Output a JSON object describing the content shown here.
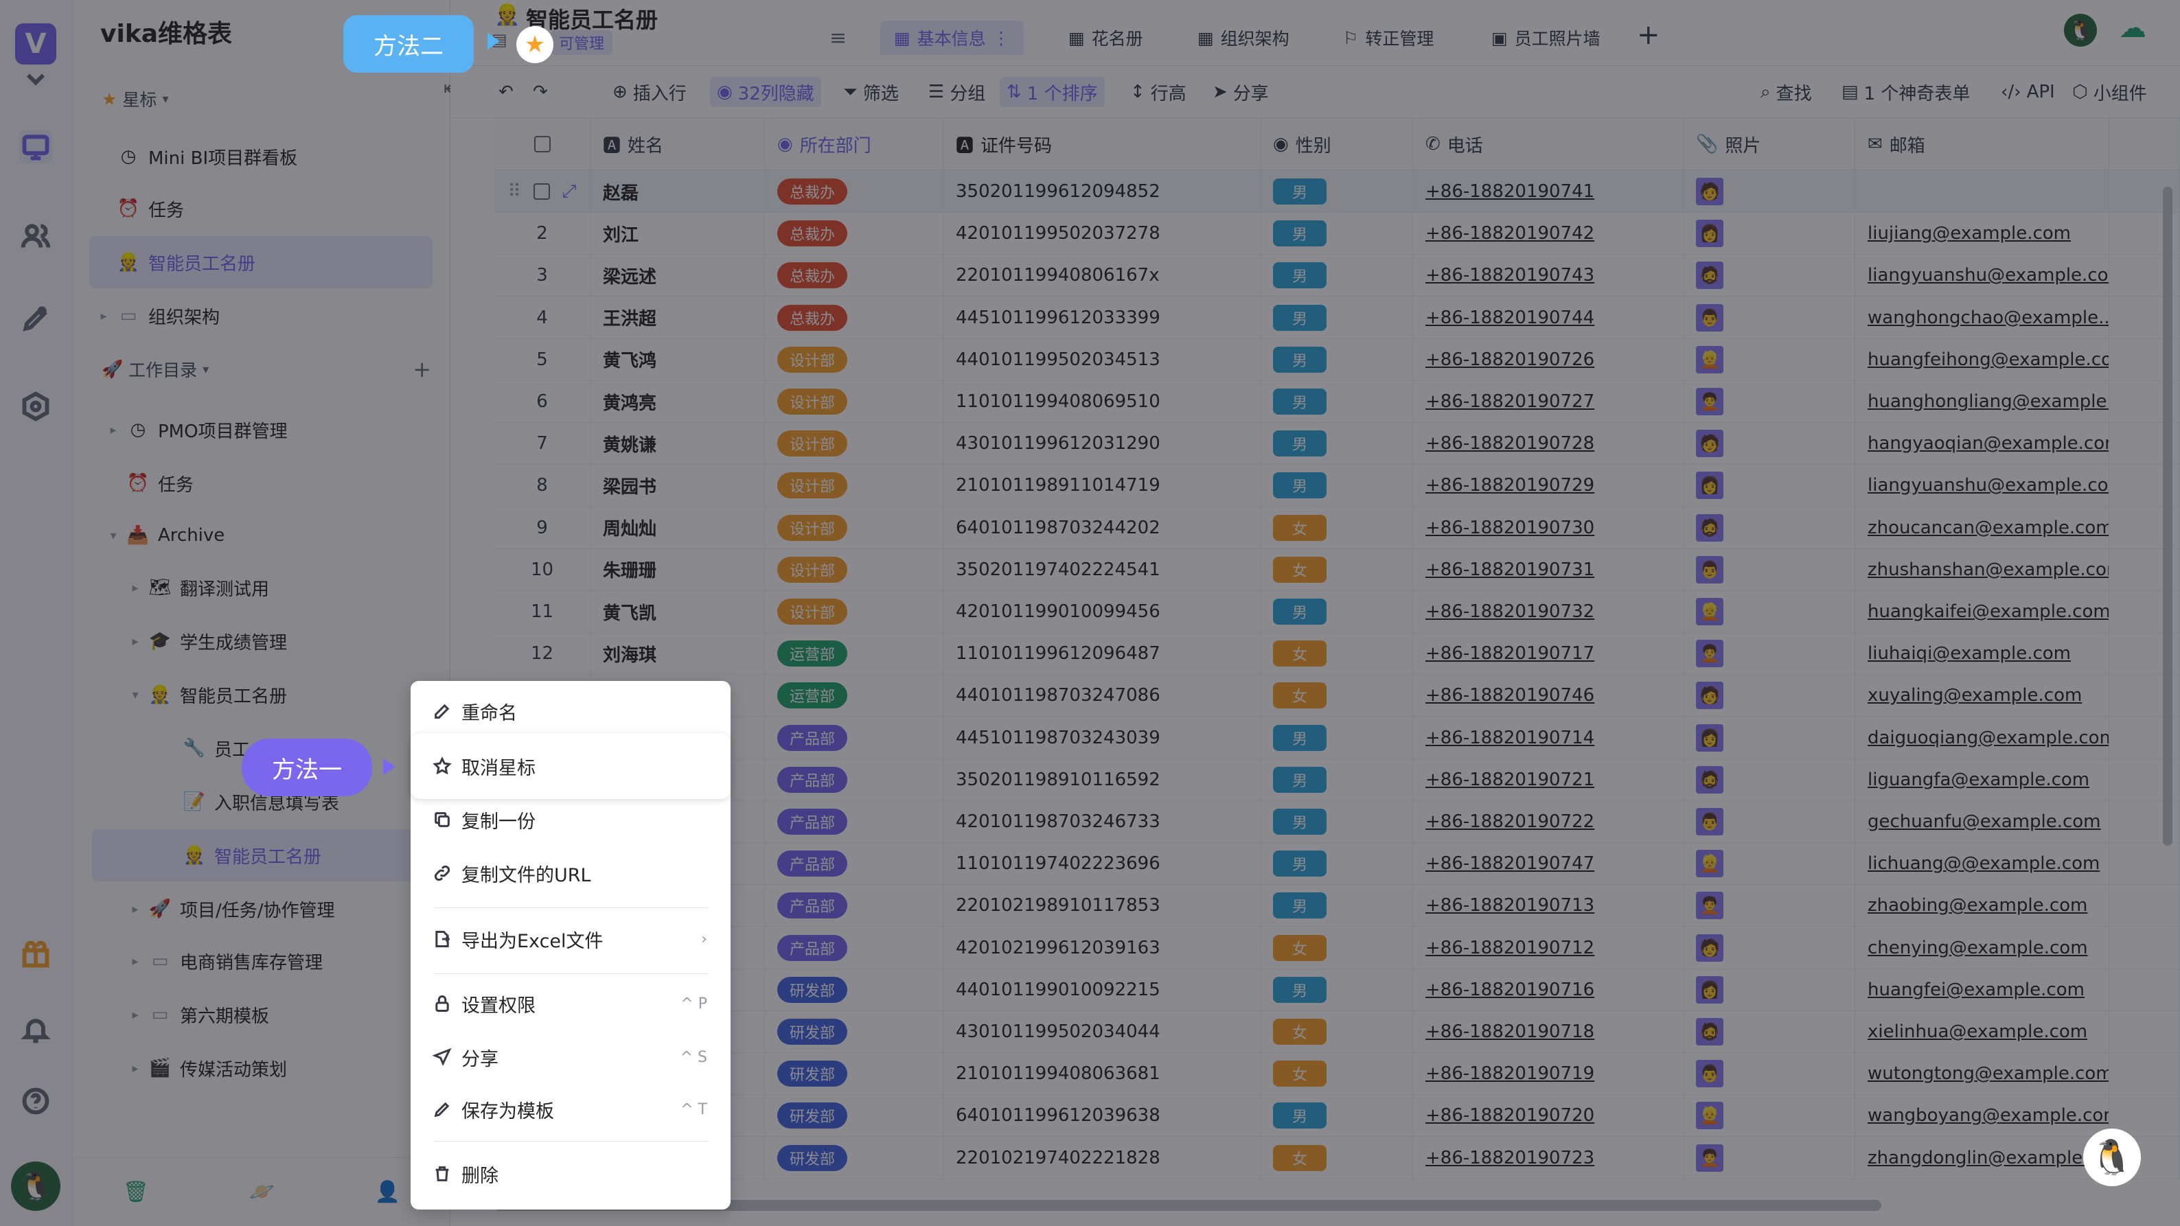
{
  "app": {
    "name": "vika维格表"
  },
  "sidebar": {
    "starred_label": "星标",
    "starred": [
      {
        "label": "Mini BI项目群看板",
        "icon": "clock-icon"
      },
      {
        "label": "任务",
        "icon": "alarm-icon"
      },
      {
        "label": "智能员工名册",
        "icon": "worker-icon"
      },
      {
        "label": "组织架构",
        "icon": "folder-icon"
      }
    ],
    "workspace_label": "工作目录",
    "tree": [
      {
        "label": "PMO项目群管理",
        "icon": "clock-icon"
      },
      {
        "label": "任务",
        "icon": "alarm-icon"
      },
      {
        "label": "Archive",
        "icon": "archive-icon"
      },
      {
        "label": "翻译测试用",
        "icon": "folder-icon"
      },
      {
        "label": "学生成绩管理",
        "icon": "folder-icon"
      },
      {
        "label": "智能员工名册",
        "icon": "worker-icon"
      },
      {
        "label": "员工",
        "icon": "wrench-icon"
      },
      {
        "label": "入职信息填写表",
        "icon": "form-icon"
      },
      {
        "label": "智能员工名册",
        "icon": "worker-icon"
      },
      {
        "label": "项目/任务/协作管理",
        "icon": "rocket-icon"
      },
      {
        "label": "电商销售库存管理",
        "icon": "folder-icon"
      },
      {
        "label": "第六期模板",
        "icon": "folder-icon"
      },
      {
        "label": "传媒活动策划",
        "icon": "folder-icon"
      }
    ]
  },
  "header": {
    "title": "智能员工名册",
    "permission": "可管理",
    "tabs": [
      "基本信息",
      "花名册",
      "组织架构",
      "转正管理",
      "员工照片墙"
    ]
  },
  "toolbar": {
    "insert_row": "插入行",
    "hidden": "32列隐藏",
    "filter": "筛选",
    "group": "分组",
    "sort": "1 个排序",
    "row_height": "行高",
    "share": "分享",
    "search": "查找",
    "form": "1 个神奇表单",
    "api": "API",
    "widget": "小组件"
  },
  "table": {
    "columns": [
      "姓名",
      "所在部门",
      "证件号码",
      "性别",
      "电话",
      "照片",
      "邮箱"
    ],
    "rows": [
      {
        "n": "",
        "name": "赵磊",
        "dept": "总裁办",
        "id": "350201199612094852",
        "sex": "男",
        "tel": "+86-18820190741",
        "mail": ""
      },
      {
        "n": "2",
        "name": "刘江",
        "dept": "总裁办",
        "id": "420101199502037278",
        "sex": "男",
        "tel": "+86-18820190742",
        "mail": "liujiang@example.com"
      },
      {
        "n": "3",
        "name": "梁远述",
        "dept": "总裁办",
        "id": "22010119940806167x",
        "sex": "男",
        "tel": "+86-18820190743",
        "mail": "liangyuanshu@example.com"
      },
      {
        "n": "4",
        "name": "王洪超",
        "dept": "总裁办",
        "id": "445101199612033399",
        "sex": "男",
        "tel": "+86-18820190744",
        "mail": "wanghongchao@example...."
      },
      {
        "n": "5",
        "name": "黄飞鸿",
        "dept": "设计部",
        "id": "440101199502034513",
        "sex": "男",
        "tel": "+86-18820190726",
        "mail": "huangfeihong@example.com"
      },
      {
        "n": "6",
        "name": "黄鸿亮",
        "dept": "设计部",
        "id": "110101199408069510",
        "sex": "男",
        "tel": "+86-18820190727",
        "mail": "huanghongliang@example...."
      },
      {
        "n": "7",
        "name": "黄姚谦",
        "dept": "设计部",
        "id": "430101199612031290",
        "sex": "男",
        "tel": "+86-18820190728",
        "mail": "hangyaoqian@example.com"
      },
      {
        "n": "8",
        "name": "梁园书",
        "dept": "设计部",
        "id": "210101198911014719",
        "sex": "男",
        "tel": "+86-18820190729",
        "mail": "liangyuanshu@example.com"
      },
      {
        "n": "9",
        "name": "周灿灿",
        "dept": "设计部",
        "id": "640101198703244202",
        "sex": "女",
        "tel": "+86-18820190730",
        "mail": "zhoucancan@example.com"
      },
      {
        "n": "10",
        "name": "朱珊珊",
        "dept": "设计部",
        "id": "350201197402224541",
        "sex": "女",
        "tel": "+86-18820190731",
        "mail": "zhushanshan@example.com"
      },
      {
        "n": "11",
        "name": "黄飞凯",
        "dept": "设计部",
        "id": "420101199010099456",
        "sex": "男",
        "tel": "+86-18820190732",
        "mail": "huangkaifei@example.com"
      },
      {
        "n": "12",
        "name": "刘海琪",
        "dept": "运营部",
        "id": "110101199612096487",
        "sex": "女",
        "tel": "+86-18820190717",
        "mail": "liuhaiqi@example.com"
      },
      {
        "n": "",
        "name": "",
        "dept": "运营部",
        "id": "440101198703247086",
        "sex": "女",
        "tel": "+86-18820190746",
        "mail": "xuyaling@example.com"
      },
      {
        "n": "",
        "name": "",
        "dept": "产品部",
        "id": "445101198703243039",
        "sex": "男",
        "tel": "+86-18820190714",
        "mail": "daiguoqiang@example.com"
      },
      {
        "n": "",
        "name": "",
        "dept": "产品部",
        "id": "350201198910116592",
        "sex": "男",
        "tel": "+86-18820190721",
        "mail": "liguangfa@example.com"
      },
      {
        "n": "",
        "name": "",
        "dept": "产品部",
        "id": "420101198703246733",
        "sex": "男",
        "tel": "+86-18820190722",
        "mail": "gechuanfu@example.com"
      },
      {
        "n": "",
        "name": "",
        "dept": "产品部",
        "id": "110101197402223696",
        "sex": "男",
        "tel": "+86-18820190747",
        "mail": "lichuang@@example.com"
      },
      {
        "n": "",
        "name": "",
        "dept": "产品部",
        "id": "220102198910117853",
        "sex": "男",
        "tel": "+86-18820190713",
        "mail": "zhaobing@example.com"
      },
      {
        "n": "",
        "name": "",
        "dept": "产品部",
        "id": "420102199612039163",
        "sex": "女",
        "tel": "+86-18820190712",
        "mail": "chenying@example.com"
      },
      {
        "n": "",
        "name": "",
        "dept": "研发部",
        "id": "440101199010092215",
        "sex": "男",
        "tel": "+86-18820190716",
        "mail": "huangfei@example.com"
      },
      {
        "n": "",
        "name": "",
        "dept": "研发部",
        "id": "430101199502034044",
        "sex": "女",
        "tel": "+86-18820190718",
        "mail": "xielinhua@example.com"
      },
      {
        "n": "",
        "name": "",
        "dept": "研发部",
        "id": "210101199408063681",
        "sex": "女",
        "tel": "+86-18820190719",
        "mail": "wutongtong@example.com"
      },
      {
        "n": "",
        "name": "",
        "dept": "研发部",
        "id": "640101199612039638",
        "sex": "男",
        "tel": "+86-18820190720",
        "mail": "wangboyang@example.com"
      },
      {
        "n": "",
        "name": "",
        "dept": "研发部",
        "id": "220102197402221828",
        "sex": "女",
        "tel": "+86-18820190723",
        "mail": "zhangdonglin@example.co"
      }
    ]
  },
  "context_menu": {
    "items": [
      {
        "label": "重命名",
        "shortcut": ""
      },
      {
        "label": "取消星标",
        "shortcut": ""
      },
      {
        "label": "复制一份",
        "shortcut": ""
      },
      {
        "label": "复制文件的URL",
        "shortcut": ""
      },
      {
        "label": "导出为Excel文件",
        "shortcut": ""
      },
      {
        "label": "设置权限",
        "shortcut": "^ P"
      },
      {
        "label": "分享",
        "shortcut": "^ S"
      },
      {
        "label": "保存为模板",
        "shortcut": "^ T"
      },
      {
        "label": "删除",
        "shortcut": ""
      }
    ]
  },
  "callouts": {
    "method_one": "方法一",
    "method_two": "方法二"
  },
  "colors": {
    "accent": "#7b67ee",
    "callout_blue": "#5ab2f3",
    "dept_zb": "#e4502e",
    "dept_sj": "#f6a12a",
    "dept_yy": "#22a56b",
    "dept_cp": "#7b67ee",
    "dept_yf": "#4466e0",
    "male": "#30a9d8",
    "female": "#f6a12a"
  }
}
